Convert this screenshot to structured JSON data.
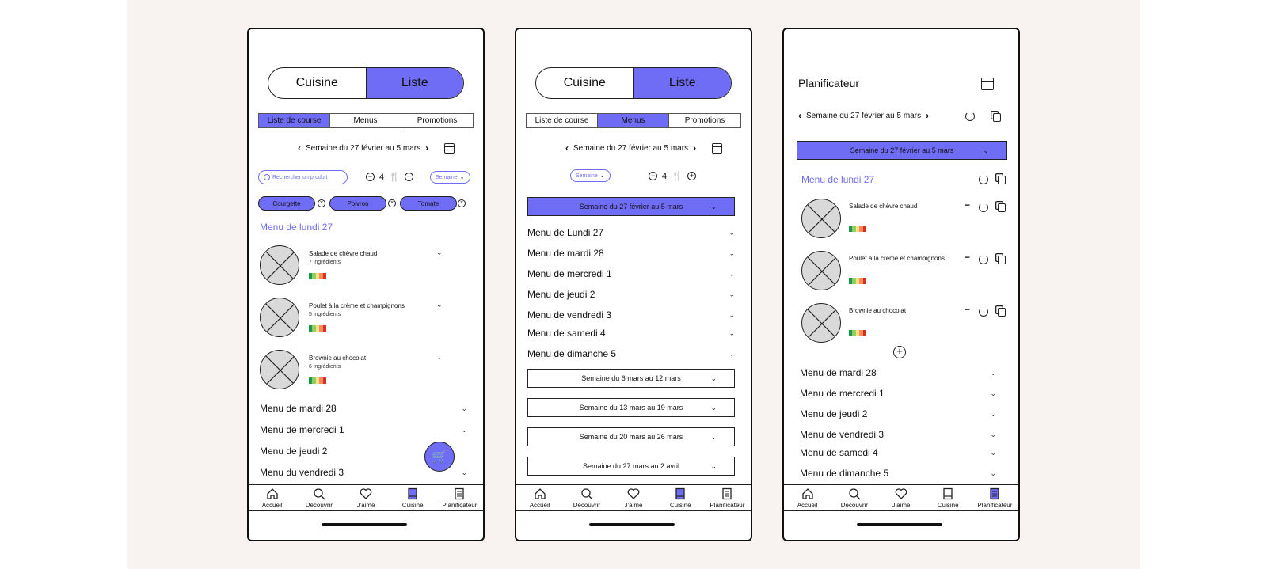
{
  "toggle": {
    "cuisine": "Cuisine",
    "liste": "Liste"
  },
  "subtabs": {
    "liste": "Liste de course",
    "menus": "Menus",
    "promos": "Promotions"
  },
  "week_label": "Semaine du 27 février au 5 mars",
  "search_placeholder": "Rechercher un produit",
  "servings": "4",
  "period_select": "Semaine",
  "chips": [
    "Courgette",
    "Poivron",
    "Tomate"
  ],
  "screen1": {
    "menu_head": "Menu de lundi 27",
    "dishes": [
      {
        "name": "Salade de chèvre chaud",
        "ingredients": "7 ingrédients"
      },
      {
        "name": "Poulet à la crème et champignons",
        "ingredients": "5 ingrédients"
      },
      {
        "name": "Brownie au chocolat",
        "ingredients": "6 ingrédients"
      }
    ],
    "days": [
      "Menu de mardi 28",
      "Menu de mercredi 1",
      "Menu de jeudi 2",
      "Menu du vendredi 3"
    ]
  },
  "screen2": {
    "days": [
      "Menu de Lundi 27",
      "Menu de mardi 28",
      "Menu de mercredi 1",
      "Menu de jeudi 2",
      "Menu de vendredi 3",
      "Menu de samedi 4",
      "Menu de dimanche 5"
    ],
    "weeks": [
      "Semaine du 6 mars au 12 mars",
      "Semaine du 13 mars au 19 mars",
      "Semaine du 20 mars au 26 mars",
      "Semaine du 27 mars au 2 avril"
    ]
  },
  "screen3": {
    "title": "Planificateur",
    "menu_head": "Menu de lundi 27",
    "dishes": [
      "Salade de chèvre chaud",
      "Poulet à la crème et champignons",
      "Brownie au chocolat"
    ],
    "days": [
      "Menu de mardi 28",
      "Menu de mercredi 1",
      "Menu de jeudi 2",
      "Menu de vendredi 3",
      "Menu de samedi 4",
      "Menu de dimanche 5"
    ]
  },
  "nav": [
    "Accueil",
    "Découvrir",
    "J'aime",
    "Cuisine",
    "Planificateur"
  ],
  "colors": {
    "accent": "#6f6cf5",
    "background": "#f8f2f1"
  },
  "icons": [
    "home-icon",
    "search-icon",
    "heart-icon",
    "book-icon",
    "notepad-icon",
    "cart-icon",
    "calendar-icon",
    "refresh-icon",
    "copy-icon"
  ]
}
